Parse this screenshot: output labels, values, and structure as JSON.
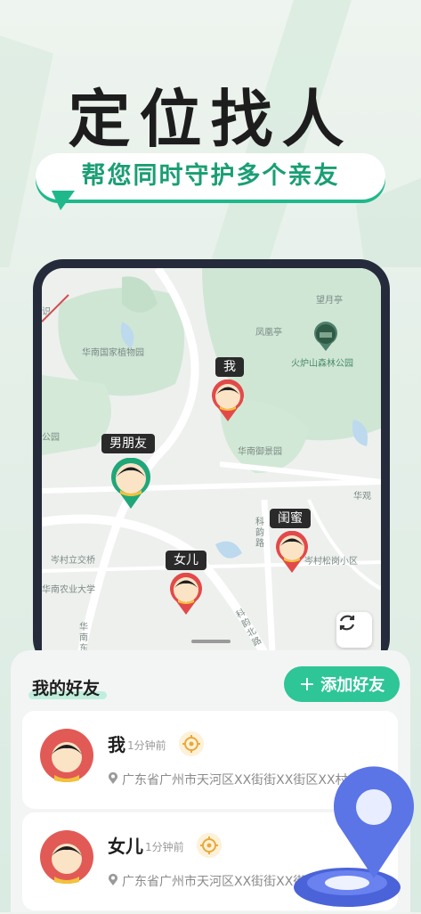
{
  "hero": {
    "title": "定位找人",
    "subtitle": "帮您同时守护多个亲友"
  },
  "map": {
    "pois": {
      "wangyue": "望月亭",
      "fenghuang": "凤凰亭",
      "huolushan": "火炉山森林公园",
      "botanical": "华南国家植物园",
      "yujing": "华南御景园",
      "park": "公园",
      "cenbridge": "岑村立交桥",
      "agri": "华南农业大学",
      "songgang": "岑村松岗小区",
      "huaguan": "华观",
      "keyun": "科韵路",
      "keyunbei": "科韵北路",
      "huadong": "华南东",
      "shi": "识"
    },
    "tags": {
      "me": "我",
      "boyfriend": "男朋友",
      "girlfriend": "闺蜜",
      "daughter": "女儿"
    }
  },
  "friends": {
    "title": "我的好友",
    "add_label": "添加好友",
    "add_icon": "+",
    "items": [
      {
        "name": "我",
        "time": "1分钟前",
        "address": "广东省广州市天河区XX街街XX街区XX村"
      },
      {
        "name": "女儿",
        "time": "1分钟前",
        "address": "广东省广州市天河区XX街街XX街区XX村"
      }
    ]
  },
  "colors": {
    "accent": "#2ec597",
    "accent_dark": "#1a9e74",
    "pin_red": "#e24a4a",
    "pin_green": "#1fa77a"
  }
}
